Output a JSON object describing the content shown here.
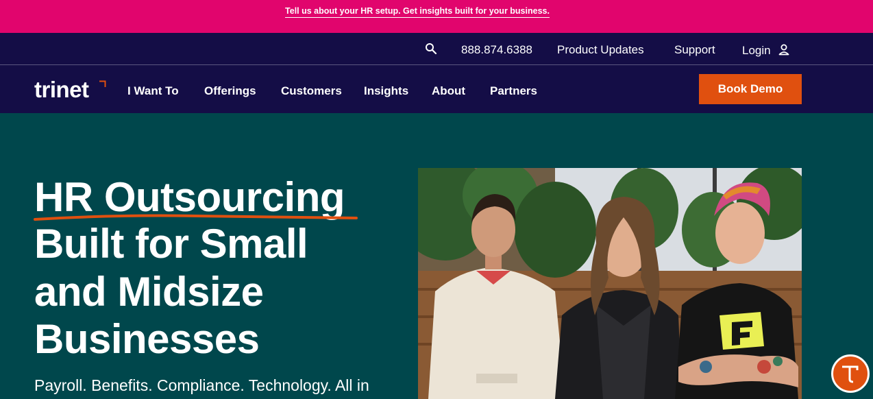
{
  "promo": {
    "text": "Tell us about your HR setup. Get insights built for your business."
  },
  "utility": {
    "phone": "888.874.6388",
    "product_updates": "Product Updates",
    "support": "Support",
    "login": "Login"
  },
  "nav": {
    "logo": "trinet",
    "items": [
      "I Want To",
      "Offerings",
      "Customers",
      "Insights",
      "About",
      "Partners"
    ],
    "cta": "Book Demo"
  },
  "hero": {
    "headline_lines": [
      "HR Outsourcing",
      "Built for Small",
      "and Midsize",
      "Businesses"
    ],
    "subhead": "Payroll. Benefits. Compliance. Technology. All in"
  },
  "colors": {
    "promo_bg": "#e1056d",
    "nav_bg": "#140d46",
    "hero_bg": "#00474c",
    "accent": "#e0500f"
  },
  "icons": [
    "search-icon",
    "user-icon",
    "chat-icon"
  ]
}
